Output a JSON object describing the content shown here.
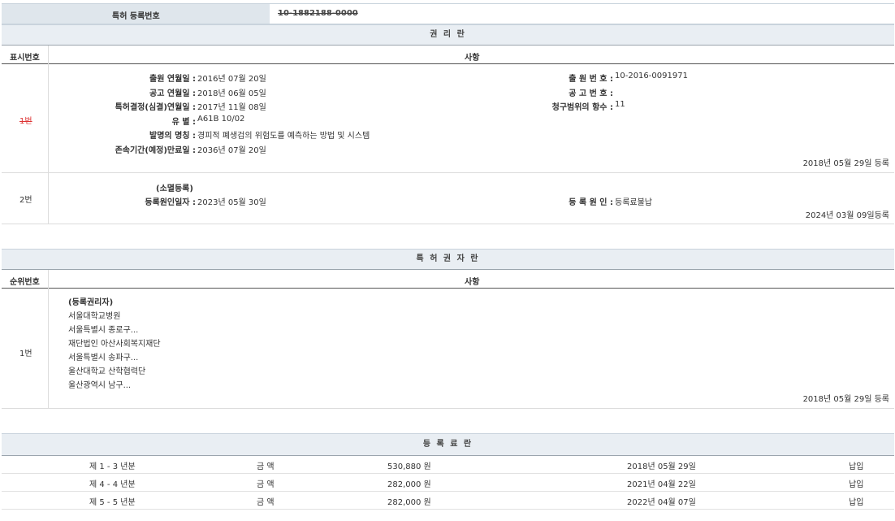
{
  "patent": {
    "label": "특허 등록번호",
    "number": "10-1882188-0000"
  },
  "rights": {
    "title": "권 리 란",
    "col_no": "표시번호",
    "col_item": "사항",
    "entry1": {
      "no": "1번",
      "left": [
        {
          "label": "출원 연월일 :",
          "value": "2016년 07월 20일"
        },
        {
          "label": "공고 연월일 :",
          "value": "2018년 06월 05일"
        },
        {
          "label": "특허결정(심결)연월일 :",
          "value": "2017년 11월 08일"
        },
        {
          "label": "유 별 :",
          "value": "A61B 10/02"
        },
        {
          "label": "발명의 명칭 :",
          "value": "경피적 폐생검의 위험도를 예측하는 방법 및 시스템"
        },
        {
          "label": "존속기간(예정)만료일 :",
          "value": "2036년 07월 20일"
        }
      ],
      "right": [
        {
          "label": "출 원 번 호 :",
          "value": "10-2016-0091971"
        },
        {
          "label": "공 고 번 호 :",
          "value": ""
        },
        {
          "label": "청구범위의 항수 :",
          "value": "11"
        }
      ],
      "registered": "2018년 05월 29일 등록"
    },
    "entry2": {
      "no": "2번",
      "kind": "(소멸등록)",
      "cause_date_label": "등록원인일자 :",
      "cause_date": "2023년 05월 30일",
      "cause_label": "등 록 원 인 :",
      "cause": "등록료불납",
      "registered": "2024년 03월 09일등록"
    }
  },
  "holders": {
    "title": "특 허 권 자 란",
    "col_no": "순위번호",
    "col_item": "사항",
    "entry": {
      "no": "1번",
      "lines": [
        "(등록권리자)",
        "서울대학교병원",
        "서울특별시 종로구...",
        "재단법인 아산사회복지재단",
        "서울특별시 송파구...",
        "울산대학교 산학협력단",
        "울산광역시 남구..."
      ],
      "registered": "2018년 05월 29일 등록"
    }
  },
  "fees": {
    "title": "등 록 료 란",
    "rows": [
      {
        "period": "제 1 - 3 년분",
        "amount_label": "금 액",
        "amount": "530,880 원",
        "date": "2018년 05월 29일",
        "status": "납입"
      },
      {
        "period": "제 4 - 4 년분",
        "amount_label": "금 액",
        "amount": "282,000 원",
        "date": "2021년 04월 22일",
        "status": "납입"
      },
      {
        "period": "제 5 - 5 년분",
        "amount_label": "금 액",
        "amount": "282,000 원",
        "date": "2022년 04월 07일",
        "status": "납입"
      }
    ]
  }
}
